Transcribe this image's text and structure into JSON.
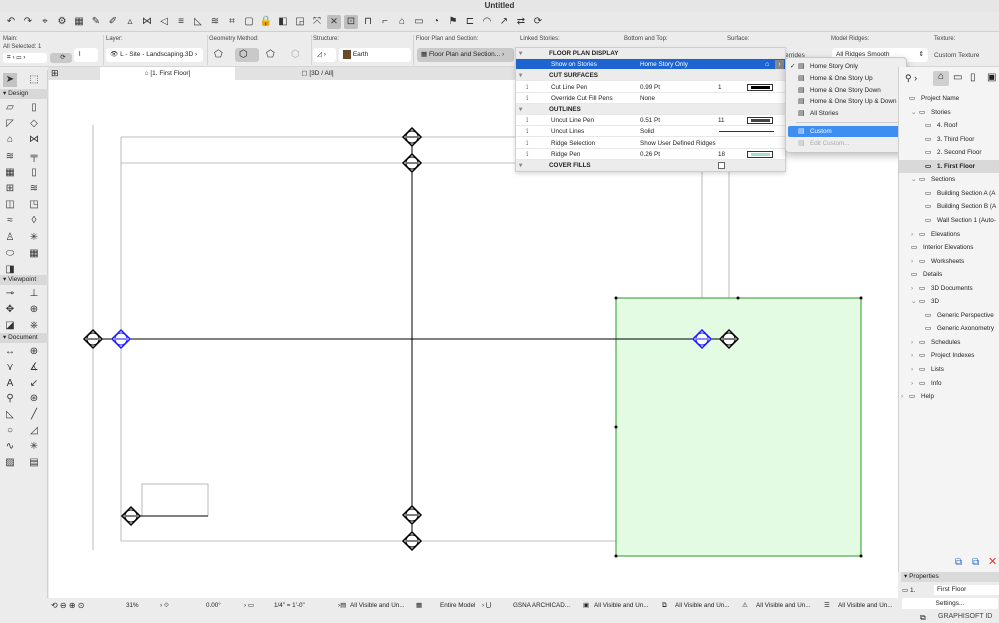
{
  "window": {
    "title": "Untitled"
  },
  "toolbar": {
    "icons": [
      "undo-icon",
      "redo-icon",
      "pointer-icon",
      "find-select-icon",
      "layers-icon",
      "eyedropper-icon",
      "syringe-icon",
      "arrow-icon",
      "mirror-icon",
      "level-icon",
      "text-style-icon",
      "pen-icon",
      "fill-icon",
      "grid-icon",
      "rectangle-icon",
      "lock-icon",
      "renovation-icon",
      "trace-icon",
      "magic-wand-icon",
      "split-icon",
      "trim-icon",
      "offset-icon",
      "fillet-icon",
      "house-icon",
      "adjust-icon",
      "intersect-icon",
      "flag-icon",
      "sign-icon",
      "dome-icon",
      "cursor-icon",
      "teamwork-icon",
      "refresh-icon"
    ]
  },
  "infobox": {
    "main_label": "Main:",
    "all_selected": "All Selected: 1",
    "layer_label": "Layer:",
    "layer_value": "L - Site - Landscaping.3D",
    "geometry_label": "Geometry Method:",
    "structure_label": "Structure:",
    "structure_value": "Earth",
    "fps_label": "Floor Plan and Section:",
    "fps_value": "Floor Plan and Section...",
    "linked_label": "Linked Stories:",
    "bottom_top_label": "Bottom and Top:",
    "surface_label": "Surface:",
    "surface_value": "errides",
    "ridges_label": "Model Ridges:",
    "ridges_value": "All Ridges Smooth",
    "texture_label": "Texture:",
    "texture_value": "Custom Texture"
  },
  "tabs": [
    {
      "label": "[1. First Floor]"
    },
    {
      "label": "[3D / All]"
    }
  ],
  "toolbox": {
    "sections": [
      {
        "label": "Design"
      },
      {
        "label": "Viewpoint"
      },
      {
        "label": "Document"
      }
    ]
  },
  "panel": {
    "rows": [
      {
        "type": "head",
        "name": "FLOOR PLAN DISPLAY"
      },
      {
        "type": "sel",
        "name": "Show on Stories",
        "value": "Home Story Only"
      },
      {
        "type": "head",
        "name": "CUT SURFACES"
      },
      {
        "name": "Cut Line Pen",
        "value": "0.99 Pt",
        "num": "1",
        "pen": "#000000"
      },
      {
        "name": "Override Cut Fill Pens",
        "value": "None"
      },
      {
        "type": "head",
        "name": "OUTLINES"
      },
      {
        "name": "Uncut Line Pen",
        "value": "0.51 Pt",
        "num": "11",
        "pen": "#444444"
      },
      {
        "name": "Uncut Lines",
        "value": "Solid"
      },
      {
        "name": "Ridge Selection",
        "value": "Show User Defined Ridges"
      },
      {
        "name": "Ridge Pen",
        "value": "0.26 Pt",
        "num": "18",
        "pen": "#a8dcd2"
      },
      {
        "type": "head",
        "name": "COVER FILLS"
      }
    ]
  },
  "menu": {
    "items": [
      {
        "label": "Home Story Only",
        "checked": true
      },
      {
        "label": "Home & One Story Up"
      },
      {
        "label": "Home & One Story Down"
      },
      {
        "label": "Home & One Story Up & Down"
      },
      {
        "label": "All Stories"
      },
      {
        "label": "Custom",
        "highlighted": true
      },
      {
        "label": "Edit Custom...",
        "disabled": true
      }
    ]
  },
  "navigator": {
    "items": [
      {
        "label": "Project Name",
        "level": 0
      },
      {
        "label": "Stories",
        "level": 1,
        "exp": "v"
      },
      {
        "label": "4. Roof",
        "level": 2
      },
      {
        "label": "3. Third Floor",
        "level": 2
      },
      {
        "label": "2. Second Floor",
        "level": 2
      },
      {
        "label": "1. First Floor",
        "level": 2,
        "selected": true
      },
      {
        "label": "Sections",
        "level": 1,
        "exp": "v"
      },
      {
        "label": "Building Section A (A",
        "level": 2
      },
      {
        "label": "Building Section B (A",
        "level": 2
      },
      {
        "label": "Wall Section 1 (Auto-",
        "level": 2
      },
      {
        "label": "Elevations",
        "level": 1,
        "exp": ">"
      },
      {
        "label": "Interior Elevations",
        "level": 1
      },
      {
        "label": "Worksheets",
        "level": 1,
        "exp": ">"
      },
      {
        "label": "Details",
        "level": 1
      },
      {
        "label": "3D Documents",
        "level": 1,
        "exp": ">"
      },
      {
        "label": "3D",
        "level": 1,
        "exp": "v"
      },
      {
        "label": "Generic Perspective",
        "level": 2
      },
      {
        "label": "Generic Axonometry",
        "level": 2
      },
      {
        "label": "Schedules",
        "level": 1,
        "exp": ">"
      },
      {
        "label": "Project Indexes",
        "level": 1,
        "exp": ">"
      },
      {
        "label": "Lists",
        "level": 1,
        "exp": ">"
      },
      {
        "label": "Info",
        "level": 1,
        "exp": ">"
      },
      {
        "label": "Help",
        "level": 0,
        "exp": ">"
      }
    ]
  },
  "properties": {
    "title": "Properties",
    "story_num": "1.",
    "story_name": "First Floor",
    "settings": "Settings...",
    "brand": "GRAPHISOFT ID"
  },
  "status": {
    "zoom": "31%",
    "angle": "0.00°",
    "scale": "1/4\"  =  1'-0\"",
    "layer_combo": "All Visible and Un...",
    "model": "Entire Model",
    "pen_set": "GSNA ARCHICAD...",
    "mvo": "All Visible and Un...",
    "graphic_override": "All Visible and Un...",
    "renovation": "All Visible and Un...",
    "dimension": "All Visible and Un..."
  },
  "colors": {
    "selection": "#1e64d0",
    "menu_highlight": "#3d8ef0",
    "green_fill": "#e3fae3",
    "green_stroke": "#2a9a2a",
    "marker_blue": "#1a1aff"
  }
}
